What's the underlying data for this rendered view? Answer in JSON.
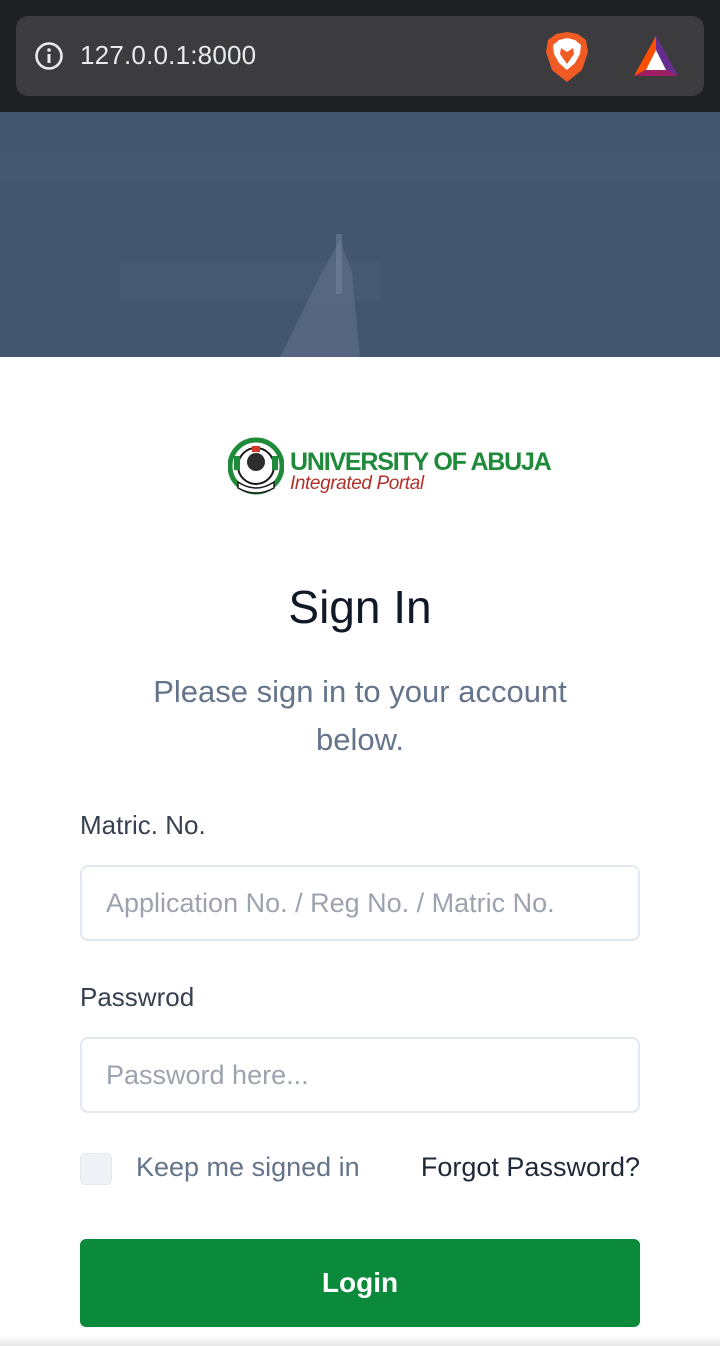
{
  "browser": {
    "url": "127.0.0.1:8000",
    "icons": [
      "info-icon",
      "brave-lion-icon",
      "bat-rewards-icon"
    ]
  },
  "hero": {
    "background_color": "#43546f"
  },
  "logo": {
    "title": "UNIVERSITY OF ABUJA",
    "subtitle": "Integrated Portal",
    "title_color": "#1f8a3a",
    "subtitle_color": "#b0312a"
  },
  "form": {
    "title": "Sign In",
    "subtitle": "Please sign in to your account below.",
    "matric_label": "Matric. No.",
    "matric_placeholder": "Application No. / Reg No. / Matric No.",
    "matric_value": "",
    "password_label": "Passwrod",
    "password_placeholder": "Password here...",
    "password_value": "",
    "remember_label": "Keep me signed in",
    "remember_checked": false,
    "forgot_label": "Forgot Password?",
    "login_label": "Login",
    "accent_color": "#0a8a3a"
  }
}
